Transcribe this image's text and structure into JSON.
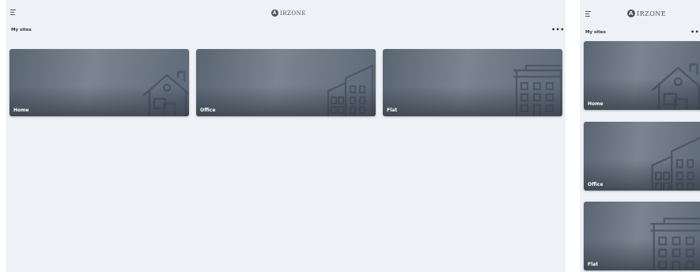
{
  "app": {
    "logo_letter": "A",
    "logo_text": "IRZONE"
  },
  "header": {
    "title": "My sites",
    "more_label": "•••"
  },
  "sites": [
    {
      "label": "Home",
      "icon": "house-icon"
    },
    {
      "label": "Office",
      "icon": "office-building-icon"
    },
    {
      "label": "Flat",
      "icon": "apartment-building-icon"
    }
  ],
  "colors": {
    "background": "#eef1f5",
    "card": "#6d7884",
    "text": "#2b333d"
  }
}
